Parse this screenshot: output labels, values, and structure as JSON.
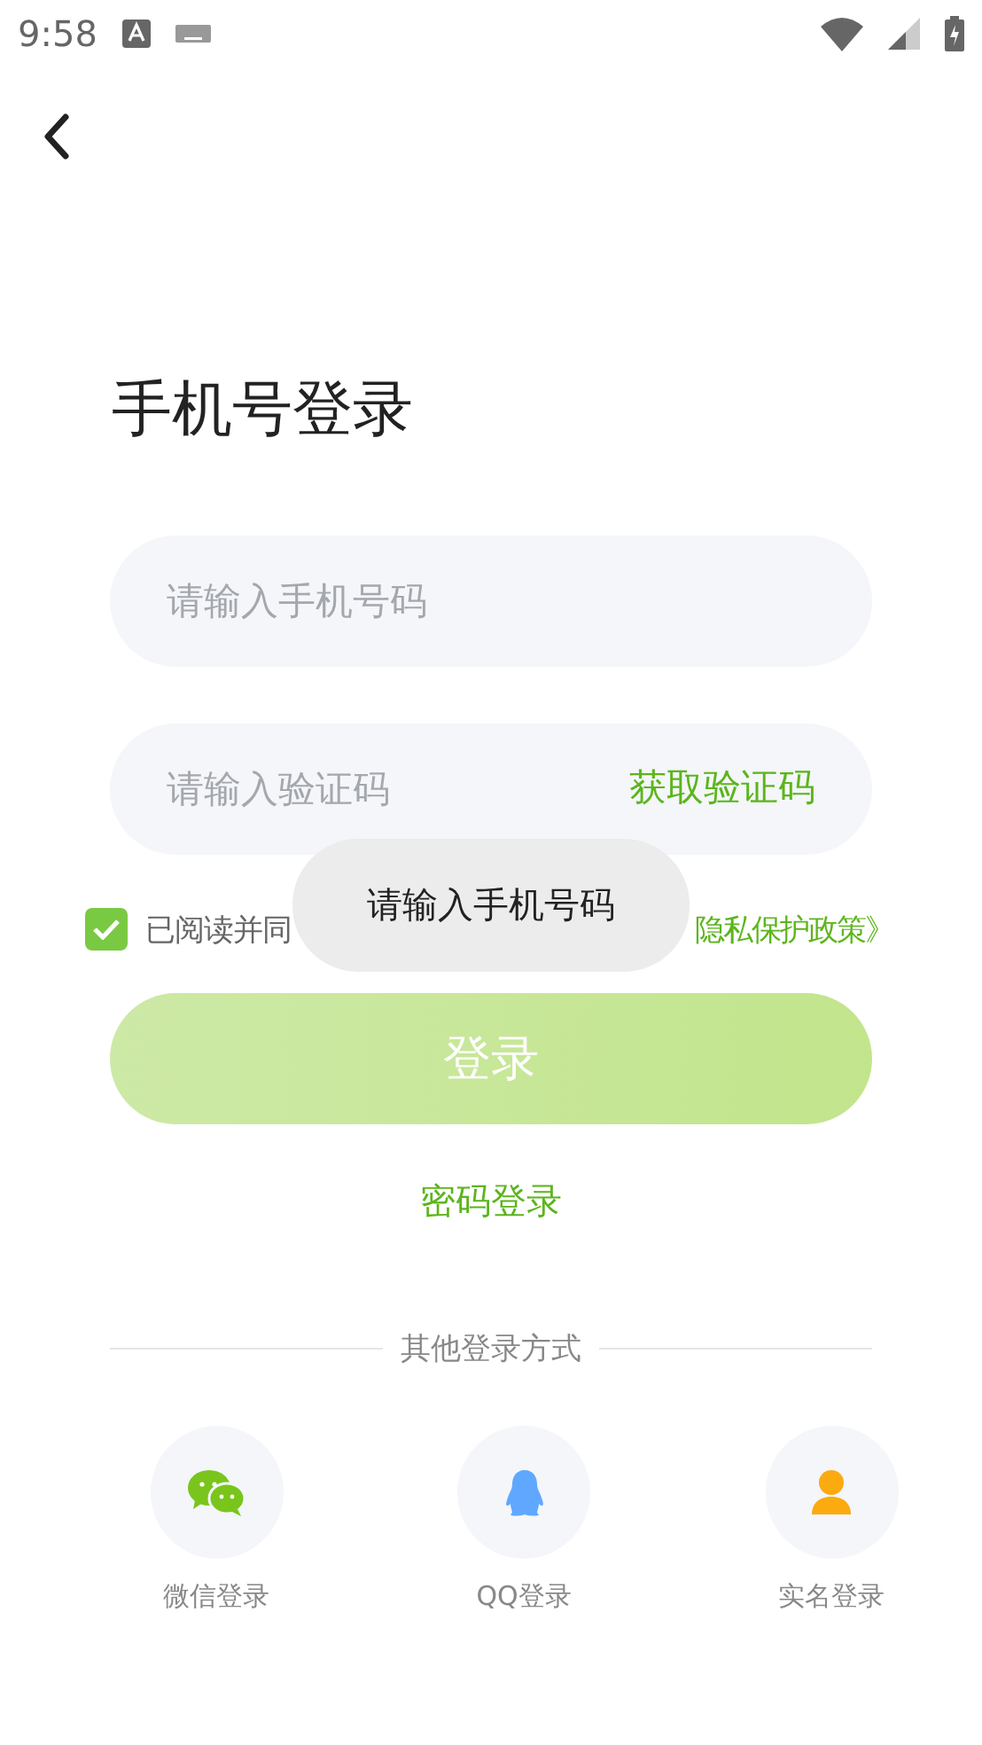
{
  "status_bar": {
    "time": "9:58"
  },
  "title": "手机号登录",
  "phone_field": {
    "placeholder": "请输入手机号码"
  },
  "code_field": {
    "placeholder": "请输入验证码",
    "action": "获取验证码"
  },
  "agreement": {
    "checked": true,
    "parts": [
      {
        "kind": "plain",
        "text": "已阅读并同"
      },
      {
        "kind": "link",
        "text": "隐私保护政策》"
      }
    ]
  },
  "login_button": {
    "label": "登录",
    "disabled": true
  },
  "password_login": "密码登录",
  "other_title": "其他登录方式",
  "other_methods": [
    {
      "kind": "wechat",
      "label": "微信登录"
    },
    {
      "kind": "qq",
      "label": "QQ登录"
    },
    {
      "kind": "person",
      "label": "实名登录"
    }
  ],
  "toast": "请输入手机号码"
}
